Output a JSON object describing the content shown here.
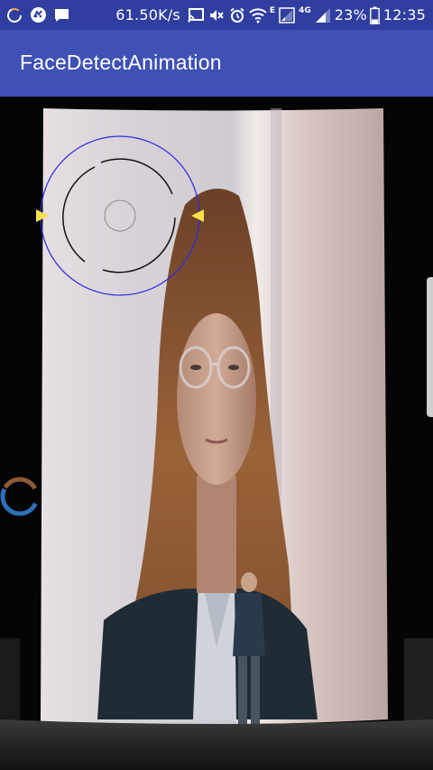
{
  "status_bar": {
    "network_speed": "61.50K/s",
    "network_type_e": "E",
    "network_type_4g": "4G",
    "battery_percent": "23%",
    "time": "12:35",
    "left_icons": [
      "loading-circle-icon",
      "cat-app-icon",
      "message-icon"
    ],
    "right_icons": [
      "cast-icon",
      "mute-icon",
      "alarm-icon",
      "wifi-icon",
      "signal-1-icon",
      "signal-2-icon",
      "battery-icon"
    ]
  },
  "toolbar": {
    "title": "FaceDetectAnimation"
  },
  "preview": {
    "description_icons": [
      "face-detect-reticle",
      "left-marker-icon",
      "right-marker-icon",
      "progress-ring-icon"
    ],
    "colors": {
      "reticle_outer": "#2B2BE0",
      "reticle_inner": "#111111",
      "marker": "#F5E04A",
      "ring_blue": "#2F6FB8",
      "ring_brown": "#8A5A3A"
    }
  }
}
